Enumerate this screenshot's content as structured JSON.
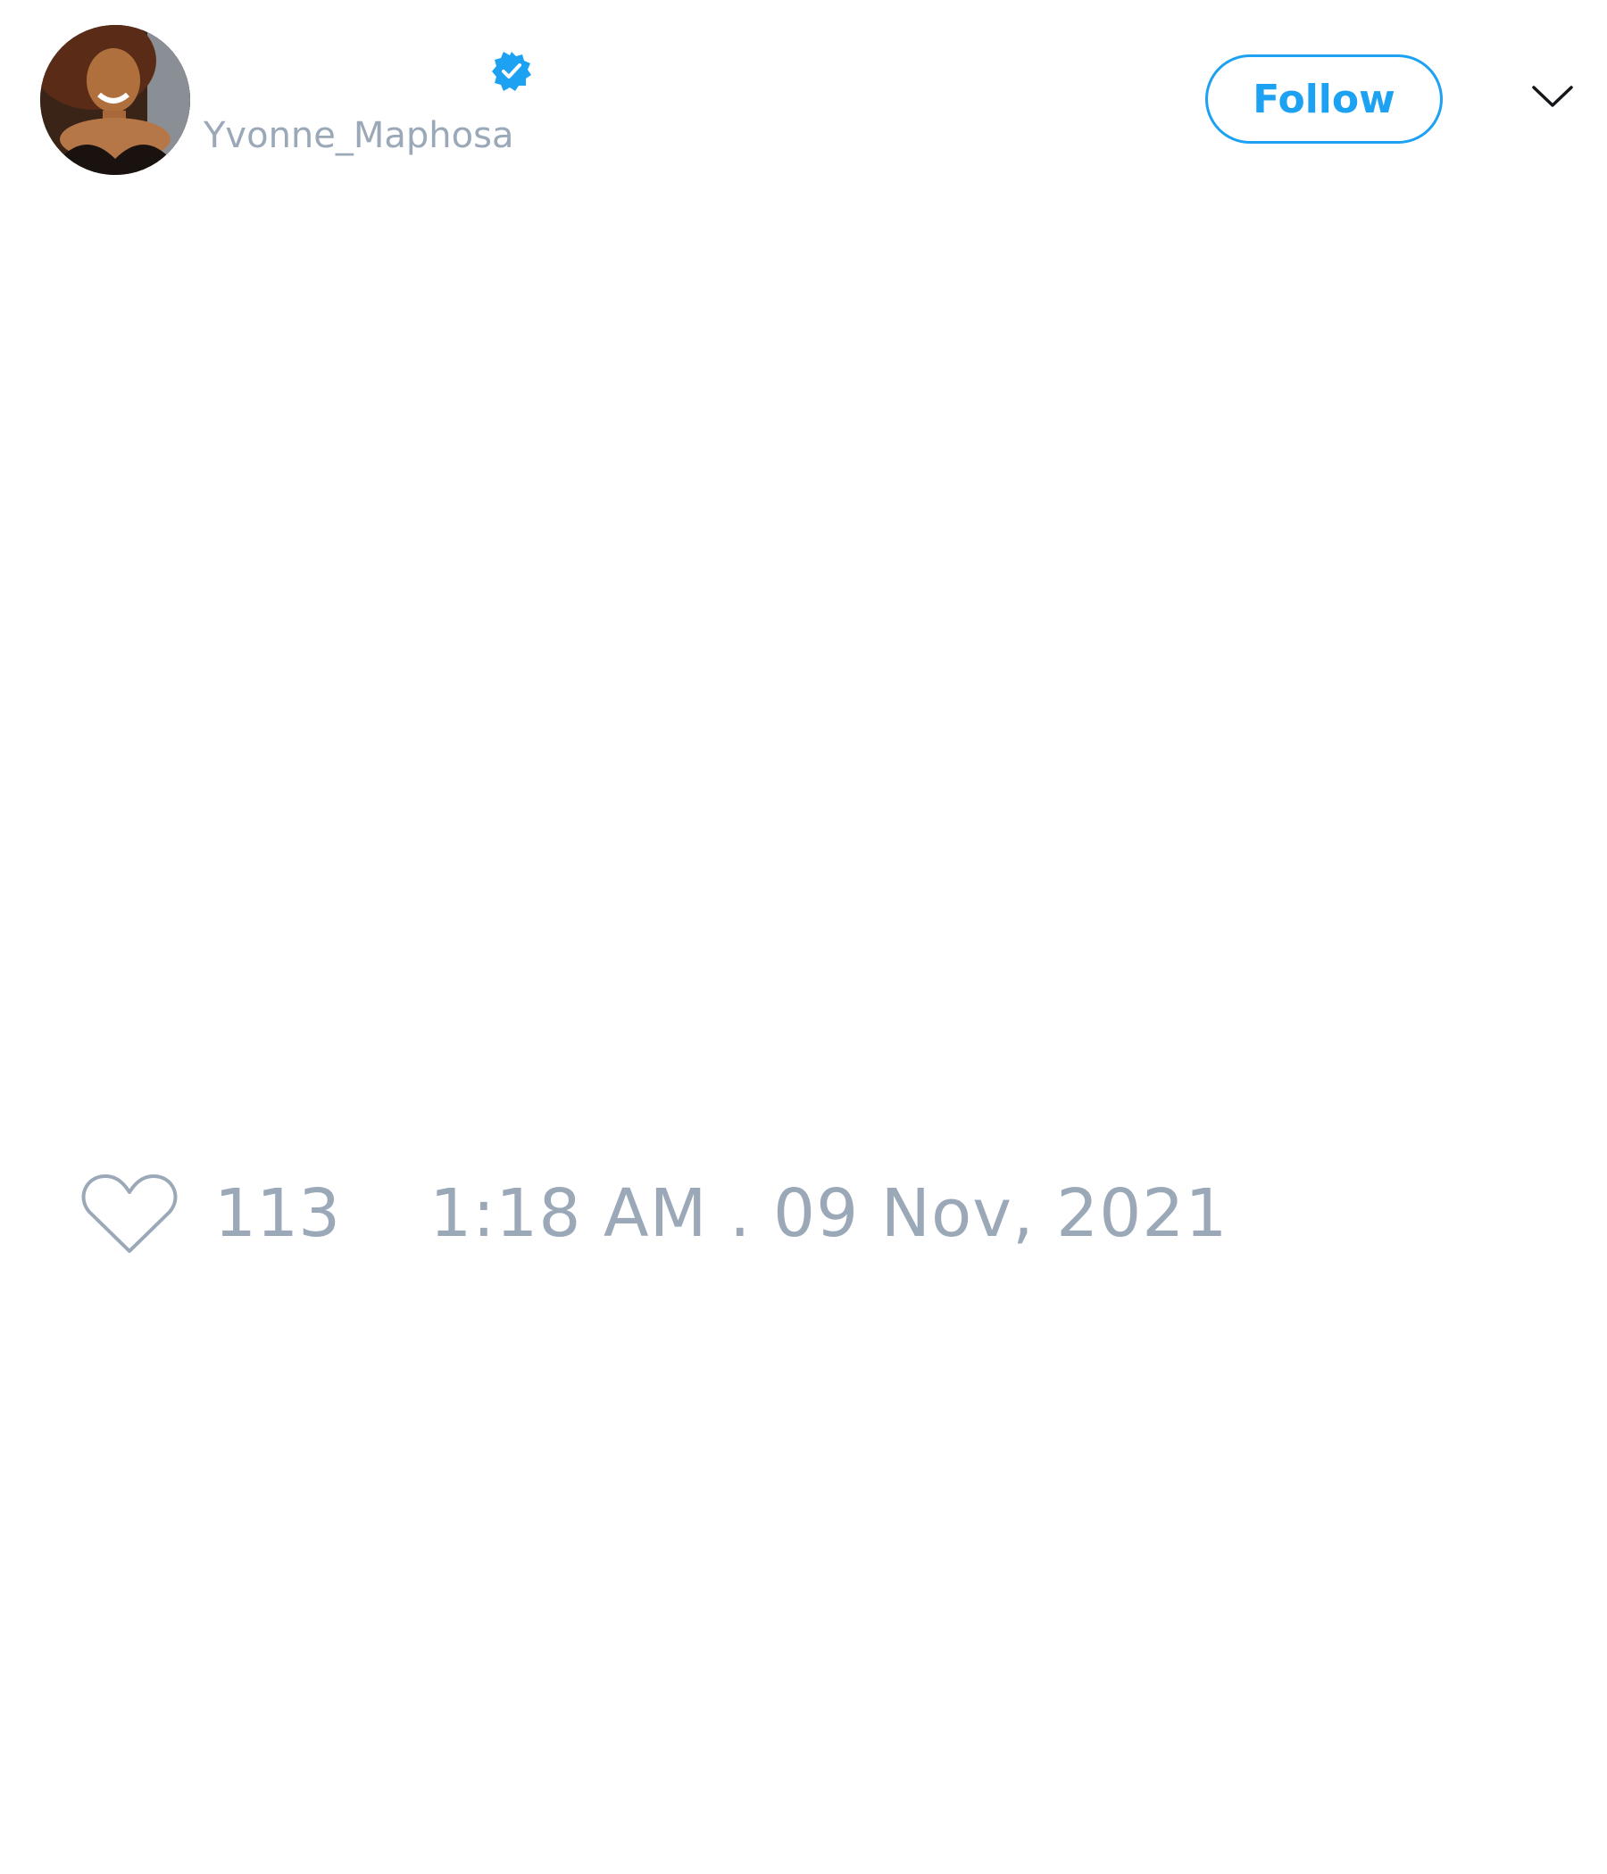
{
  "author": {
    "display_name": "",
    "handle": "Yvonne_Maphosa",
    "verified": true,
    "avatar_icon": "profile-photo"
  },
  "header": {
    "follow_label": "Follow",
    "menu_icon": "chevron-down-icon"
  },
  "tweet": {
    "text": ""
  },
  "actions": {
    "like_icon": "heart-outline-icon",
    "like_count": "113",
    "timestamp": "1:18 AM . 09 Nov, 2021"
  },
  "colors": {
    "accent": "#1da1f2",
    "muted_text": "#9aa8b8",
    "background": "#ffffff"
  }
}
